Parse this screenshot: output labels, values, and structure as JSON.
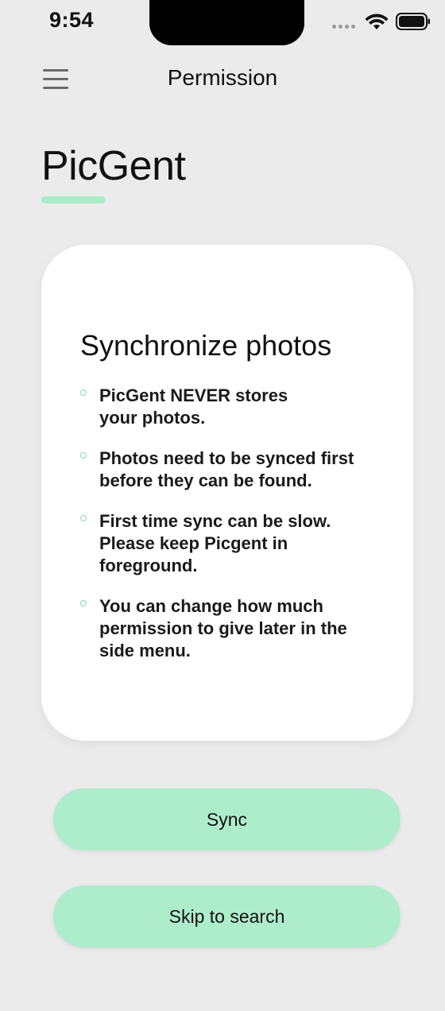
{
  "status_bar": {
    "time": "9:54"
  },
  "nav": {
    "title": "Permission",
    "menu_icon": "hamburger-menu-icon"
  },
  "brand": {
    "name": "PicGent",
    "accent_color": "#a8ecc9"
  },
  "card": {
    "title": "Synchronize photos",
    "bullets": [
      "PicGent NEVER stores\nyour photos.",
      "Photos need to be synced first before they can be found.",
      "First time sync can be slow. Please keep Picgent in foreground.",
      "You can change how much permission to give later in the side menu."
    ]
  },
  "actions": {
    "sync_label": "Sync",
    "skip_label": "Skip to search",
    "button_color": "#aeedcc"
  }
}
